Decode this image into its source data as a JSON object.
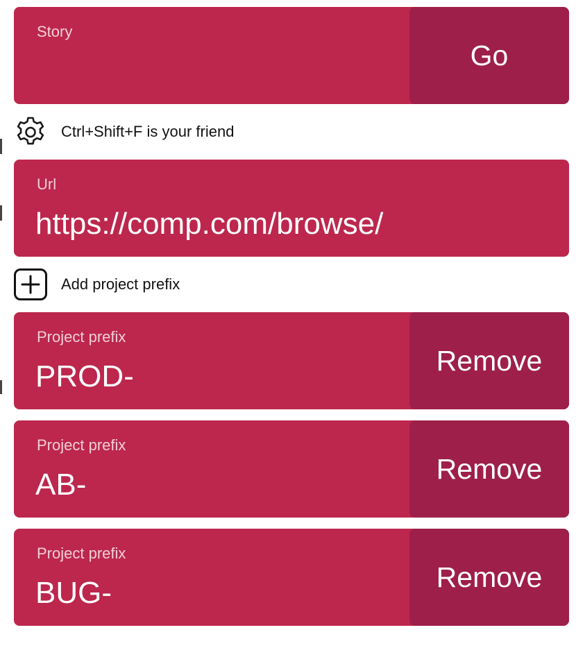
{
  "story": {
    "label": "Story",
    "value": "",
    "button_label": "Go"
  },
  "settings_row": {
    "icon": "gear-icon",
    "text": "Ctrl+Shift+F is your friend"
  },
  "url": {
    "label": "Url",
    "value": "https://comp.com/browse/"
  },
  "add_prefix_row": {
    "icon": "plus-square-icon",
    "text": "Add project prefix"
  },
  "prefixes": [
    {
      "label": "Project prefix",
      "value": "PROD-",
      "button_label": "Remove"
    },
    {
      "label": "Project prefix",
      "value": "AB-",
      "button_label": "Remove"
    },
    {
      "label": "Project prefix",
      "value": "BUG-",
      "button_label": "Remove"
    }
  ],
  "colors": {
    "card": "#bd274d",
    "action": "#9e1f4a",
    "text": "#ffffff"
  }
}
